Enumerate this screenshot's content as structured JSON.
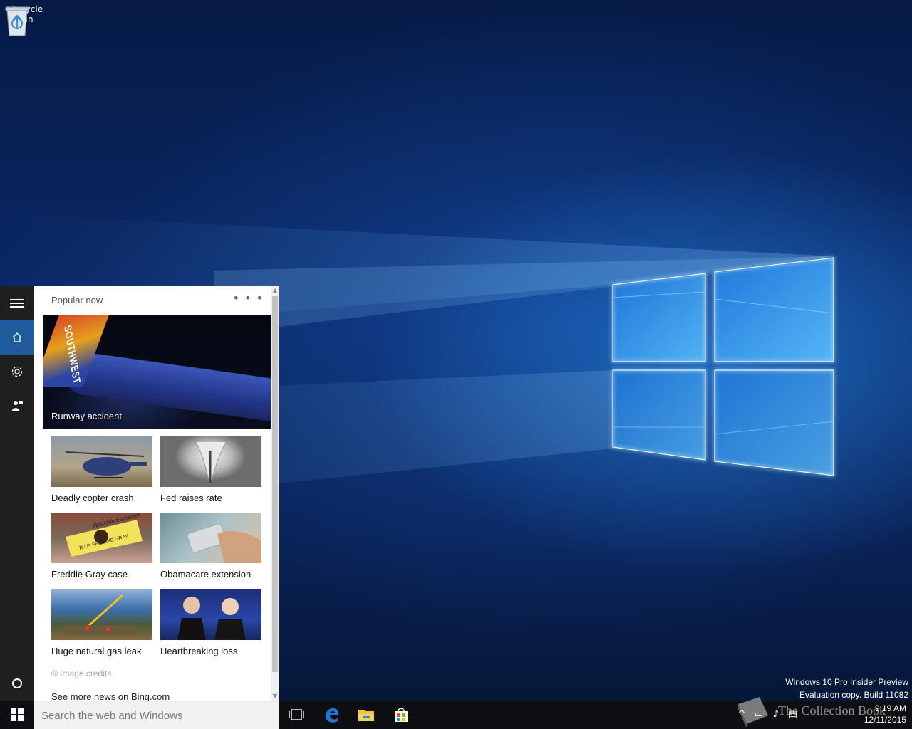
{
  "desktop": {
    "recycle_bin_label": "Recycle Bin",
    "watermark_line1": "Windows 10 Pro Insider Preview",
    "watermark_line2": "Evaluation copy. Build 11082"
  },
  "cortana": {
    "rail": {
      "menu_icon": "hamburger-icon",
      "home_icon": "home-icon",
      "settings_icon": "gear-icon",
      "feedback_icon": "feedback-icon",
      "cortana_icon": "circle-icon"
    },
    "header": "Popular now",
    "hero": {
      "tail_text": "SOUTHWEST",
      "caption": "Runway accident"
    },
    "news": [
      {
        "label": "Deadly copter crash"
      },
      {
        "label": "Fed raises rate"
      },
      {
        "label": "Freddie Gray case",
        "banner_text": "#blacklivesmatter",
        "sign_text": "R.I.P. FREDDIE GRAY"
      },
      {
        "label": "Obamacare extension"
      },
      {
        "label": "Huge natural gas leak"
      },
      {
        "label": "Heartbreaking loss"
      }
    ],
    "image_credits": "© Image credits",
    "bing_link": "See more news on Bing.com"
  },
  "taskbar": {
    "search_placeholder": "Search the web and Windows",
    "pinned": [
      "task-view-icon",
      "edge-icon",
      "file-explorer-icon",
      "store-icon"
    ],
    "clock_time": "9:19 AM",
    "clock_date": "12/11/2015",
    "brand_overlay": "The Collection Book"
  },
  "colors": {
    "rail_bg": "#1f1f1f",
    "active_rail": "#1e5a9c",
    "taskbar_bg": "#0e0f12",
    "edge_blue": "#1e7ad8"
  }
}
